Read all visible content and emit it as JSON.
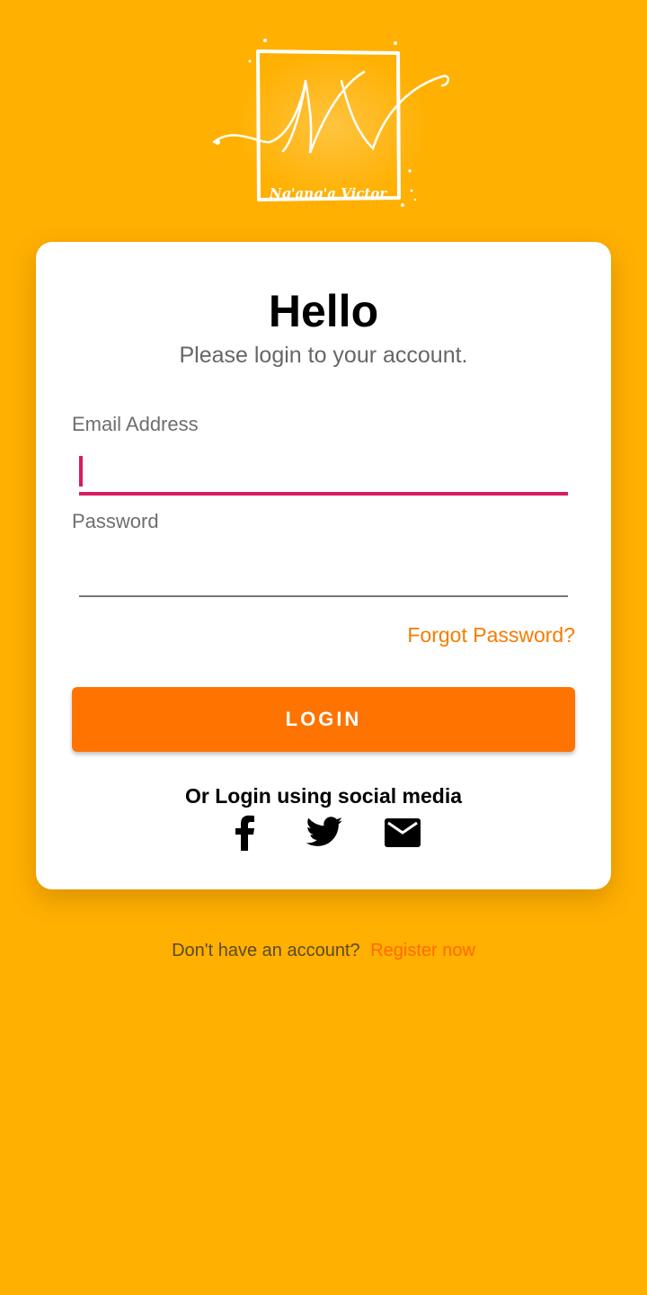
{
  "logo": {
    "icon": "nv-monogram-logo",
    "text": "Ng'ang'a Victor",
    "monogram": "NV"
  },
  "card": {
    "title": "Hello",
    "subtitle": "Please login to your account."
  },
  "form": {
    "email_label": "Email Address",
    "email_value": "",
    "password_label": "Password",
    "password_value": "",
    "forgot_label": "Forgot Password?",
    "login_label": "LOGIN"
  },
  "social": {
    "heading": "Or Login using social media",
    "icons": [
      "facebook-icon",
      "twitter-icon",
      "mail-icon"
    ]
  },
  "footer": {
    "text": "Don't have an account?",
    "register_label": "Register now"
  },
  "colors": {
    "background": "#FFB000",
    "card": "#FFFFFF",
    "accent": "#FF7300",
    "link": "#F57C00",
    "focus_underline": "#D81B60"
  }
}
